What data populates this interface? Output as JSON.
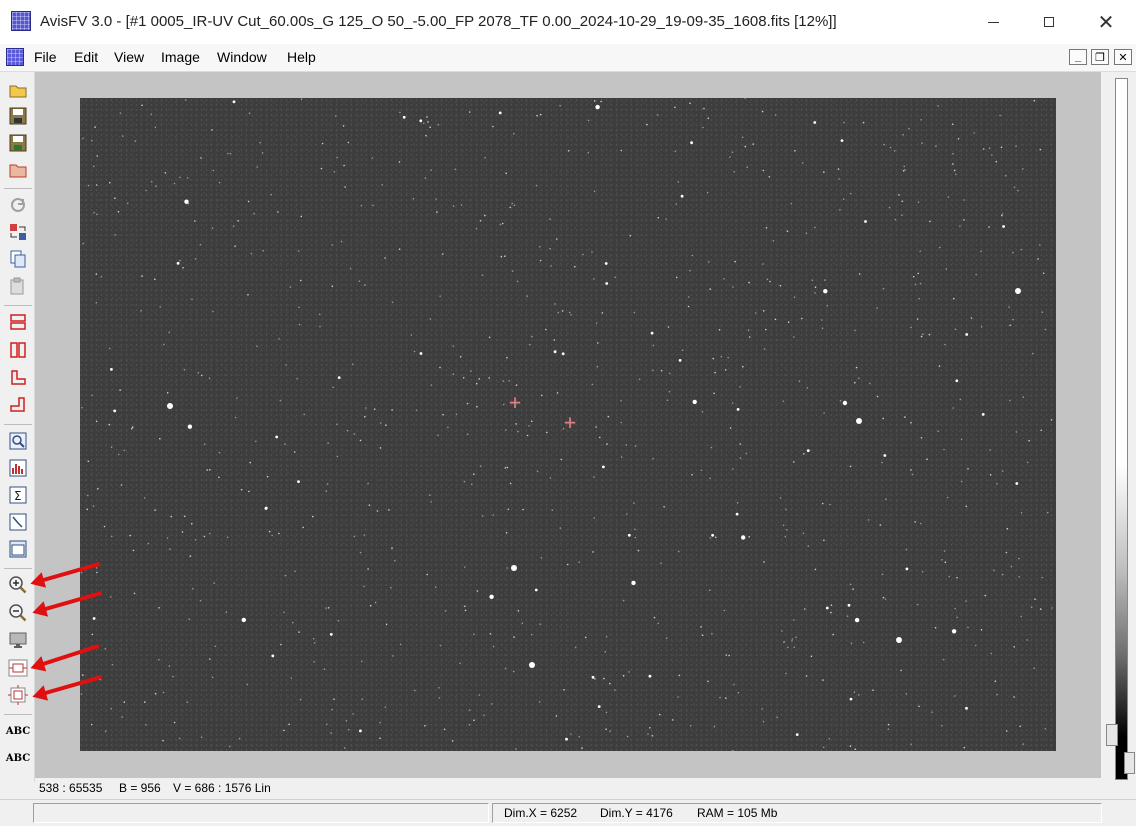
{
  "window": {
    "title": "AvisFV 3.0 - [#1 0005_IR-UV Cut_60.00s_G 125_O 50_-5.00_FP 2078_TF 0.00_2024-10-29_19-09-35_1608.fits  [12%]]",
    "minimize_icon": "minimize-icon",
    "maximize_icon": "maximize-icon",
    "close_icon": "close-icon",
    "close_glyph": "✕"
  },
  "menu": {
    "items": [
      "File",
      "Edit",
      "View",
      "Image",
      "Window",
      "Help"
    ],
    "mdi_minimize": "_",
    "mdi_restore": "❐",
    "mdi_close": "✕"
  },
  "toolbar": {
    "buttons": [
      {
        "icon": "open-folder-icon",
        "color": "#d9a520"
      },
      {
        "icon": "save-icon",
        "color": "#7a6a3a"
      },
      {
        "icon": "save-as-icon",
        "color": "#7a6a3a"
      },
      {
        "icon": "browse-folder-icon",
        "color": "#c0392b"
      },
      {
        "icon": "refresh-icon",
        "color": "#9a9a9a"
      },
      {
        "icon": "convert-icon",
        "color": "#c0392b"
      },
      {
        "icon": "copy-icon",
        "color": "#3060a0"
      },
      {
        "icon": "paste-icon",
        "color": "#9a9a9a"
      },
      {
        "icon": "split-horizontal-icon",
        "color": "#d02020"
      },
      {
        "icon": "split-vertical-icon",
        "color": "#d02020"
      },
      {
        "icon": "corner-left-icon",
        "color": "#d02020"
      },
      {
        "icon": "corner-right-icon",
        "color": "#d02020"
      },
      {
        "icon": "zoom-inspect-icon",
        "color": "#305080"
      },
      {
        "icon": "histogram-icon",
        "color": "#c03030"
      },
      {
        "icon": "sigma-icon",
        "color": "#305080"
      },
      {
        "icon": "curve-icon",
        "color": "#305080"
      },
      {
        "icon": "window-icon",
        "color": "#305080"
      },
      {
        "icon": "zoom-in-icon",
        "color": "#505050"
      },
      {
        "icon": "zoom-out-icon",
        "color": "#505050"
      },
      {
        "icon": "monitor-icon",
        "color": "#606060"
      },
      {
        "icon": "fit-window-icon",
        "color": "#c03030"
      },
      {
        "icon": "actual-size-icon",
        "color": "#c03030"
      },
      {
        "icon": "text-abc-icon",
        "color": "#202020"
      },
      {
        "icon": "text-abc-edit-icon",
        "color": "#202020"
      }
    ],
    "abc_label": "ABC"
  },
  "image": {
    "zoom": "12%",
    "markers": [
      "+",
      "+"
    ]
  },
  "info": {
    "value_range": "538 : 65535",
    "b": "B = 956",
    "v": "V = 686 : 1576 Lin"
  },
  "status": {
    "dim_x": "Dim.X = 6252",
    "dim_y": "Dim.Y = 4176",
    "ram": "RAM = 105 Mb"
  },
  "colors": {
    "annotation_arrow": "#e01010",
    "marker": "#e08080",
    "image_background": "#3d3d3d"
  }
}
